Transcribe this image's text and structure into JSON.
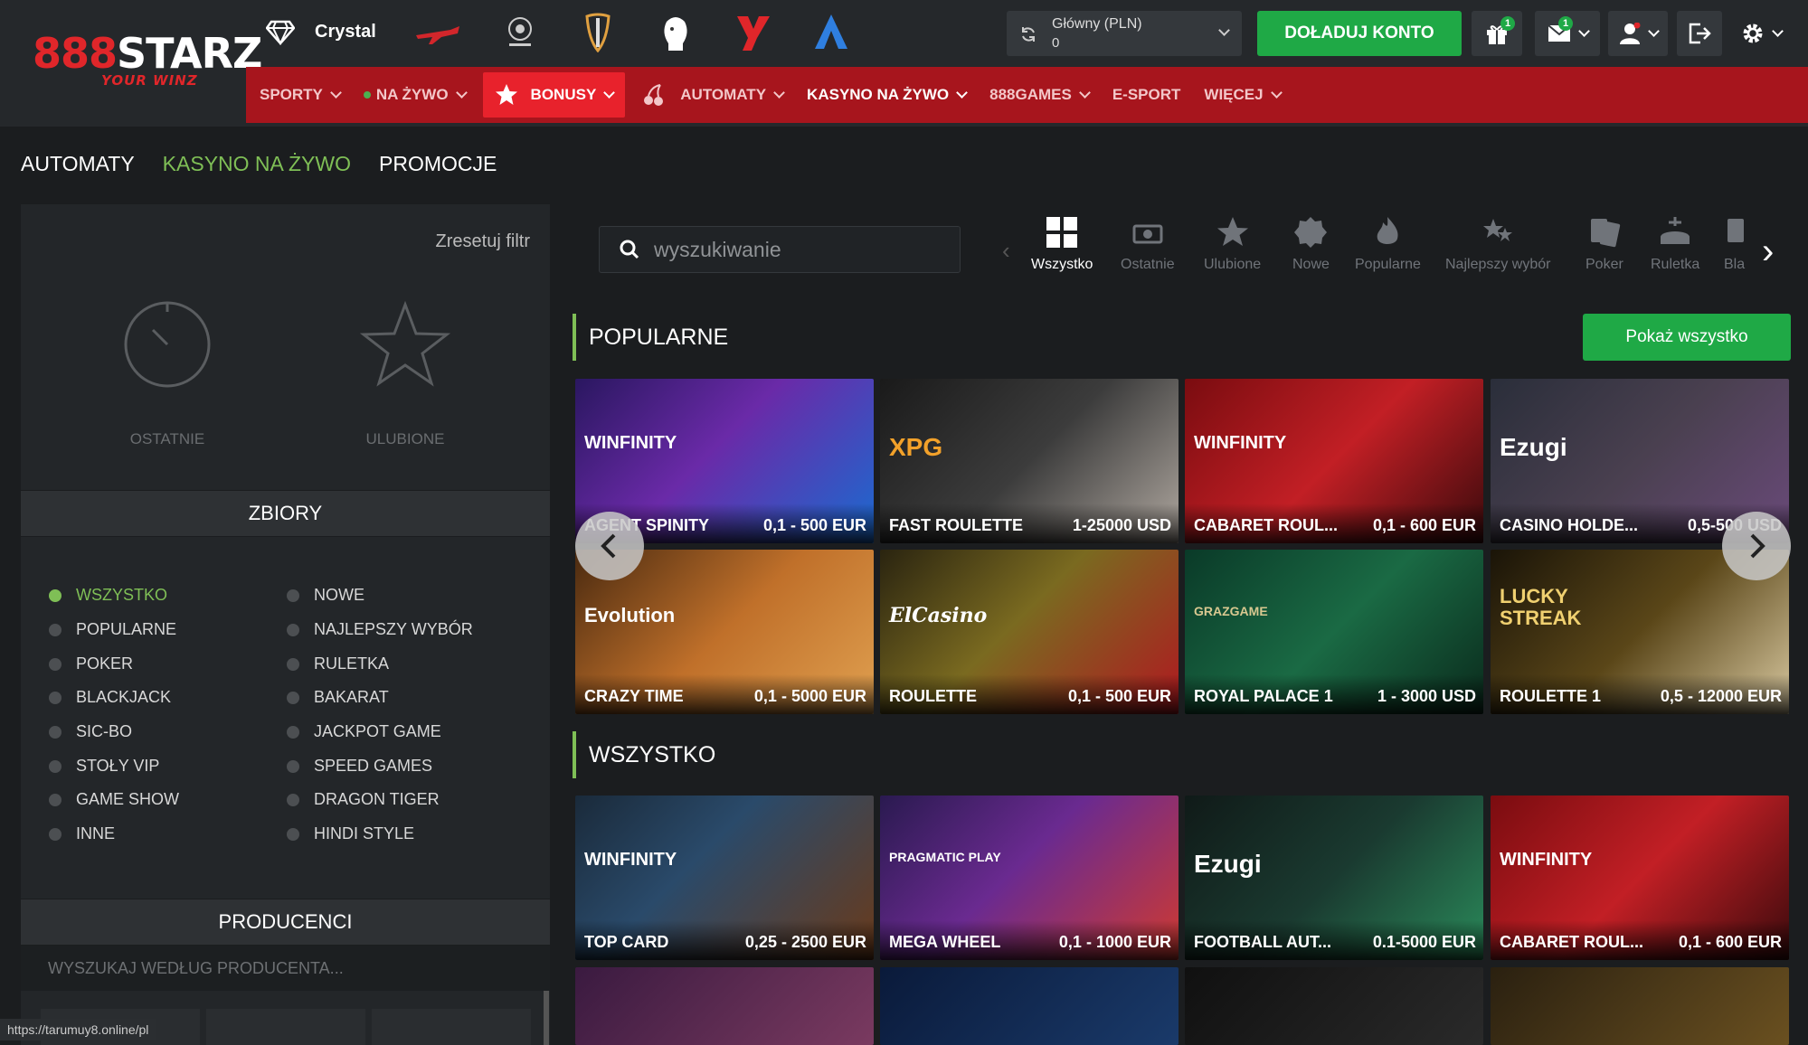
{
  "header": {
    "logo_brand": "888STARZ",
    "logo_tagline": "YOUR WINZ",
    "crystal_label": "Crystal",
    "account_label": "Główny (PLN)",
    "account_balance": "0",
    "deposit_label": "DOŁADUJ KONTO",
    "gift_badge": "1",
    "mail_badge": "1",
    "top_icons": [
      "diamond-icon",
      "plane-icon",
      "champions-league-icon",
      "europa-league-icon",
      "premier-league-icon",
      "brand-y-icon",
      "brand-a-icon"
    ]
  },
  "nav": {
    "items": [
      {
        "label": "SPORTY"
      },
      {
        "label": "NA ŻYWO"
      },
      {
        "label": "BONUSY"
      },
      {
        "label": "AUTOMATY"
      },
      {
        "label": "KASYNO NA ŻYWO"
      },
      {
        "label": "888GAMES"
      },
      {
        "label": "E-SPORT"
      },
      {
        "label": "WIĘCEJ"
      }
    ]
  },
  "subtabs": [
    "AUTOMATY",
    "KASYNO NA ŻYWO",
    "PROMOCJE"
  ],
  "filter": {
    "reset_label": "Zresetuj filtr",
    "recent_label": "OSTATNIE",
    "favorites_label": "ULUBIONE"
  },
  "collections": {
    "title": "ZBIORY",
    "left": [
      "WSZYSTKO",
      "POPULARNE",
      "POKER",
      "BLACKJACK",
      "SIC-BO",
      "STOŁY VIP",
      "GAME SHOW",
      "INNE"
    ],
    "right": [
      "NOWE",
      "NAJLEPSZY WYBÓR",
      "RULETKA",
      "BAKARAT",
      "JACKPOT GAME",
      "SPEED GAMES",
      "DRAGON TIGER",
      "HINDI STYLE"
    ]
  },
  "producers": {
    "title": "PRODUCENCI",
    "search_placeholder": "WYSZUKAJ WEDŁUG PRODUCENTA..."
  },
  "search": {
    "placeholder": "wyszukiwanie"
  },
  "categories": [
    "Wszystko",
    "Ostatnie",
    "Ulubione",
    "Nowe",
    "Popularne",
    "Najlepszy wybór",
    "Poker",
    "Ruletka",
    "Bla"
  ],
  "popular": {
    "title": "POPULARNE",
    "show_all": "Pokaż wszystko",
    "games": [
      {
        "name": "AGENT SPINITY",
        "range": "0,1 - 500 EUR",
        "provider": "WINFINITY"
      },
      {
        "name": "FAST ROULETTE",
        "range": "1-25000 USD",
        "provider": "XPG"
      },
      {
        "name": "CABARET ROUL...",
        "range": "0,1 - 600 EUR",
        "provider": "WINFINITY"
      },
      {
        "name": "CASINO HOLDE...",
        "range": "0,5-500 USD",
        "provider": "Ezugi"
      },
      {
        "name": "CRAZY TIME",
        "range": "0,1 - 5000 EUR",
        "provider": "Evolution"
      },
      {
        "name": "ROULETTE",
        "range": "0,1 - 500 EUR",
        "provider": "ElCasino"
      },
      {
        "name": "ROYAL PALACE 1",
        "range": "1 - 3000 USD",
        "provider": "GRAZGAME"
      },
      {
        "name": "ROULETTE 1",
        "range": "0,5 - 12000 EUR",
        "provider": "LUCKY STREAK"
      }
    ]
  },
  "all": {
    "title": "WSZYSTKO",
    "games": [
      {
        "name": "TOP CARD",
        "range": "0,25 - 2500 EUR",
        "provider": "WINFINITY"
      },
      {
        "name": "MEGA WHEEL",
        "range": "0,1 - 1000 EUR",
        "provider": "PRAGMATIC PLAY"
      },
      {
        "name": "FOOTBALL AUT...",
        "range": "0.1-5000 EUR",
        "provider": "Ezugi"
      },
      {
        "name": "CABARET ROUL...",
        "range": "0,1 - 600 EUR",
        "provider": "WINFINITY"
      }
    ]
  },
  "status_url": "https://tarumuy8.online/pl"
}
